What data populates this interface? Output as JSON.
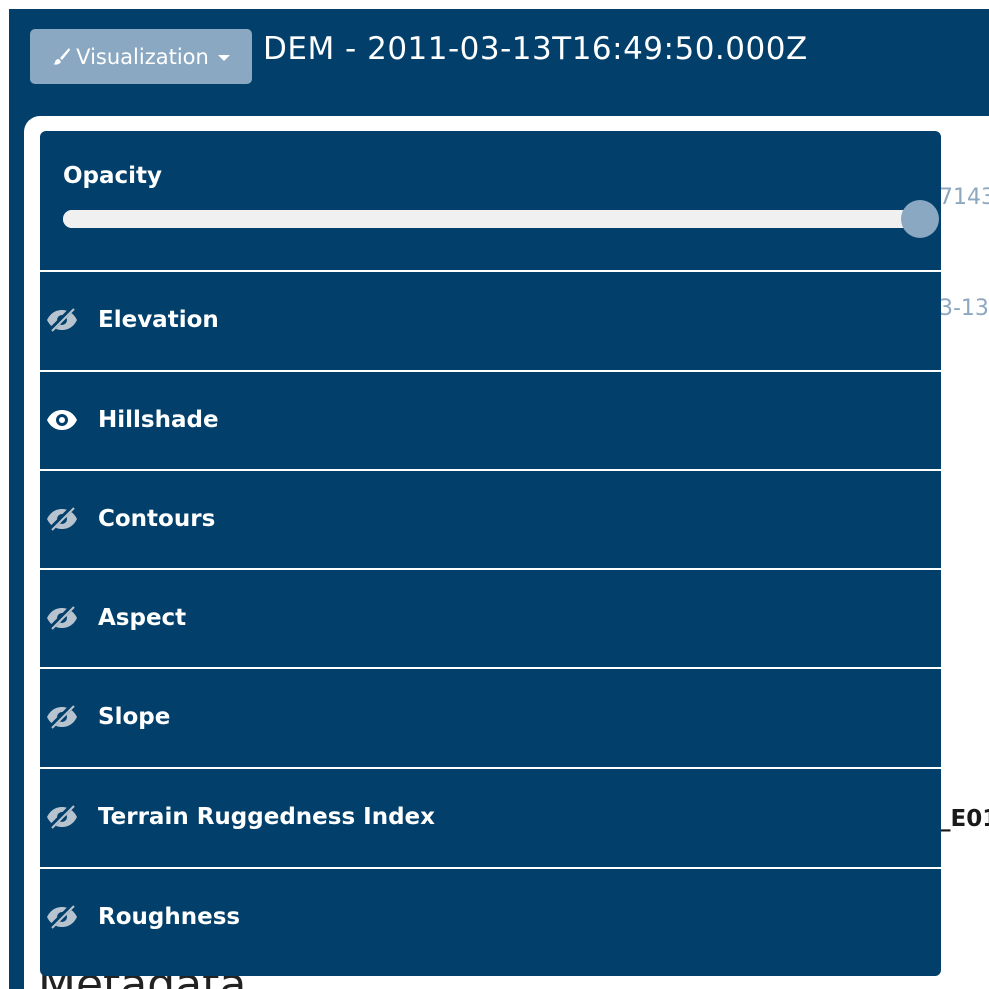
{
  "header": {
    "visualization_button": "Visualization",
    "title": "DEM - 2011-03-13T16:49:50.000Z"
  },
  "background": {
    "partial_text_1": "7143",
    "partial_text_2": "3-13",
    "partial_text_3": "_E01",
    "heading": "Metadata"
  },
  "visualization_menu": {
    "opacity": {
      "label": "Opacity",
      "value": 1.0
    },
    "layers": [
      {
        "label": "Elevation",
        "visible": false,
        "icon": "eye-slash-icon"
      },
      {
        "label": "Hillshade",
        "visible": true,
        "icon": "eye-icon"
      },
      {
        "label": "Contours",
        "visible": false,
        "icon": "eye-slash-icon"
      },
      {
        "label": "Aspect",
        "visible": false,
        "icon": "eye-slash-icon"
      },
      {
        "label": "Slope",
        "visible": false,
        "icon": "eye-slash-icon"
      },
      {
        "label": "Terrain Ruggedness Index",
        "visible": false,
        "icon": "eye-slash-icon"
      },
      {
        "label": "Roughness",
        "visible": false,
        "icon": "eye-slash-icon"
      }
    ]
  },
  "colors": {
    "primary": "#02406b",
    "button": "#8aa8c2",
    "muted_text": "#8ea7c0",
    "eye_hidden": "#b7c3cf",
    "eye_visible": "#ffffff"
  }
}
